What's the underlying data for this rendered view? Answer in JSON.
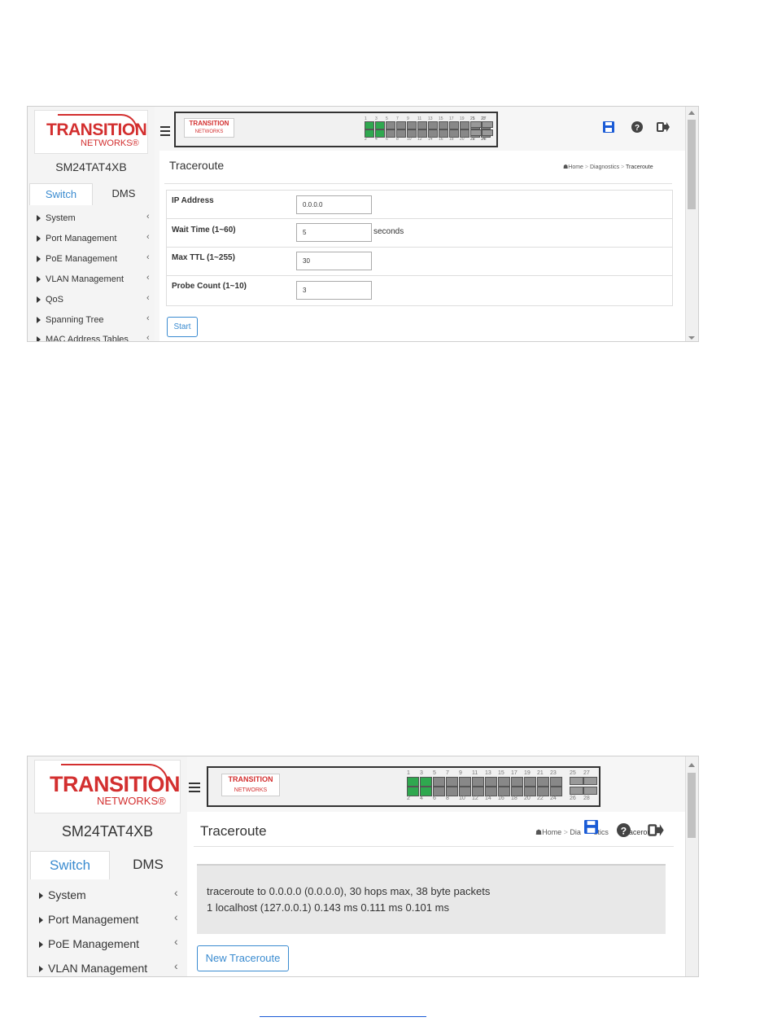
{
  "brand": {
    "line1": "TRANSITION",
    "line2": "NETWORKS®",
    "panel_logo_1": "TRANSITION",
    "panel_logo_2": "NETWORKS"
  },
  "device_model": "SM24TAT4XB",
  "sidebar_tabs": [
    "Switch",
    "DMS"
  ],
  "menu_top": [
    "System",
    "Port Management",
    "PoE Management",
    "VLAN Management",
    "QoS",
    "Spanning Tree",
    "MAC Address Tables"
  ],
  "menu_bottom": [
    "System",
    "Port Management",
    "PoE Management",
    "VLAN Management"
  ],
  "page_title": "Traceroute",
  "breadcrumb": {
    "home": "Home",
    "sep": ">",
    "diagnostics": "Diagnostics",
    "current": "Traceroute"
  },
  "breadcrumb_bottom": {
    "home": "Home",
    "sep": ">",
    "diagnostics_part": "Dia",
    "diagnostics_part2": "stics",
    "current_part": "raceroute"
  },
  "form": {
    "ip_label": "IP Address",
    "ip_value": "0.0.0.0",
    "wait_label": "Wait Time (1~60)",
    "wait_value": "5",
    "wait_unit": "seconds",
    "ttl_label": "Max TTL (1~255)",
    "ttl_value": "30",
    "probe_label": "Probe Count (1~10)",
    "probe_value": "3"
  },
  "start_label": "Start",
  "result": {
    "line1": "traceroute to 0.0.0.0 (0.0.0.0), 30 hops max, 38 byte packets",
    "line2": "1 localhost (127.0.0.1) 0.143 ms 0.111 ms 0.101 ms"
  },
  "new_traceroute_label": "New Traceroute",
  "port_labels_top": [
    "1",
    "3",
    "5",
    "7",
    "9",
    "11",
    "13",
    "15",
    "17",
    "19",
    "21",
    "23",
    "25",
    "27"
  ],
  "port_labels_bottom": [
    "2",
    "4",
    "6",
    "8",
    "10",
    "12",
    "14",
    "16",
    "18",
    "20",
    "22",
    "24",
    "26",
    "28"
  ],
  "icons": {
    "save": "save-icon",
    "help": "help-icon",
    "logout": "logout-icon",
    "home": "home-icon",
    "menu": "hamburger-icon"
  },
  "colors": {
    "brand_red": "#d32f2f",
    "accent_blue": "#3a8bd0",
    "port_up": "#2fa84f",
    "save_blue": "#1a5bd6"
  }
}
